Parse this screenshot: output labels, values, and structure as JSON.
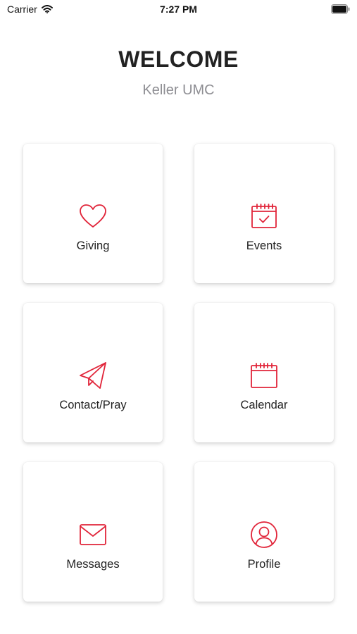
{
  "status_bar": {
    "carrier": "Carrier",
    "time": "7:27 PM"
  },
  "header": {
    "title": "WELCOME",
    "subtitle": "Keller UMC"
  },
  "tiles": [
    {
      "label": "Giving",
      "icon": "heart-icon"
    },
    {
      "label": "Events",
      "icon": "calendar-check-icon"
    },
    {
      "label": "Contact/Pray",
      "icon": "paper-plane-icon"
    },
    {
      "label": "Calendar",
      "icon": "calendar-icon"
    },
    {
      "label": "Messages",
      "icon": "envelope-icon"
    },
    {
      "label": "Profile",
      "icon": "user-circle-icon"
    }
  ],
  "colors": {
    "accent": "#e1253a",
    "subtitle": "#8e8e93",
    "text": "#222222"
  }
}
